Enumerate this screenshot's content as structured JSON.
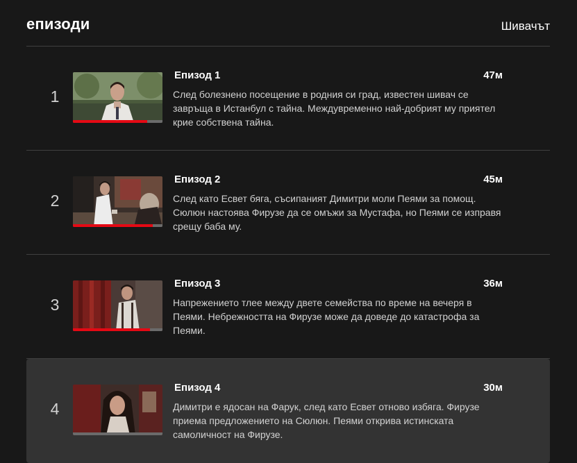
{
  "header": {
    "title": "епизоди",
    "show_name": "Шивачът"
  },
  "episodes": [
    {
      "index": "1",
      "title": "Епизод 1",
      "duration": "47м",
      "description": "След болезнено посещение в родния си град, известен шивач се завръща в Истанбул с тайна. Междувременно най-добрият му приятел крие собствена тайна.",
      "progress": 0.83
    },
    {
      "index": "2",
      "title": "Епизод 2",
      "duration": "45м",
      "description": "След като Есвет бяга, съсипаният Димитри моли Пеями за помощ. Сюлюн настоява Фирузе да се омъжи за Мустафа, но Пеями се изправя срещу баба му.",
      "progress": 0.89
    },
    {
      "index": "3",
      "title": "Епизод 3",
      "duration": "36м",
      "description": "Напрежението тлее между двете семейства по време на вечеря в Пеями. Небрежността на Фирузе може да доведе до катастрофа за Пеями.",
      "progress": 0.86
    },
    {
      "index": "4",
      "title": "Епизод 4",
      "duration": "30м",
      "description": "Димитри е ядосан на Фарук, след като Есвет отново избяга. Фирузе приема предложението на Сюлюн. Пеями открива истинската самоличност на Фирузе.",
      "progress": 0
    }
  ],
  "colors": {
    "background": "#181818",
    "active_row": "#333333",
    "divider": "#404040",
    "progress_fill": "#e50914",
    "progress_track": "#6b6b6b"
  }
}
